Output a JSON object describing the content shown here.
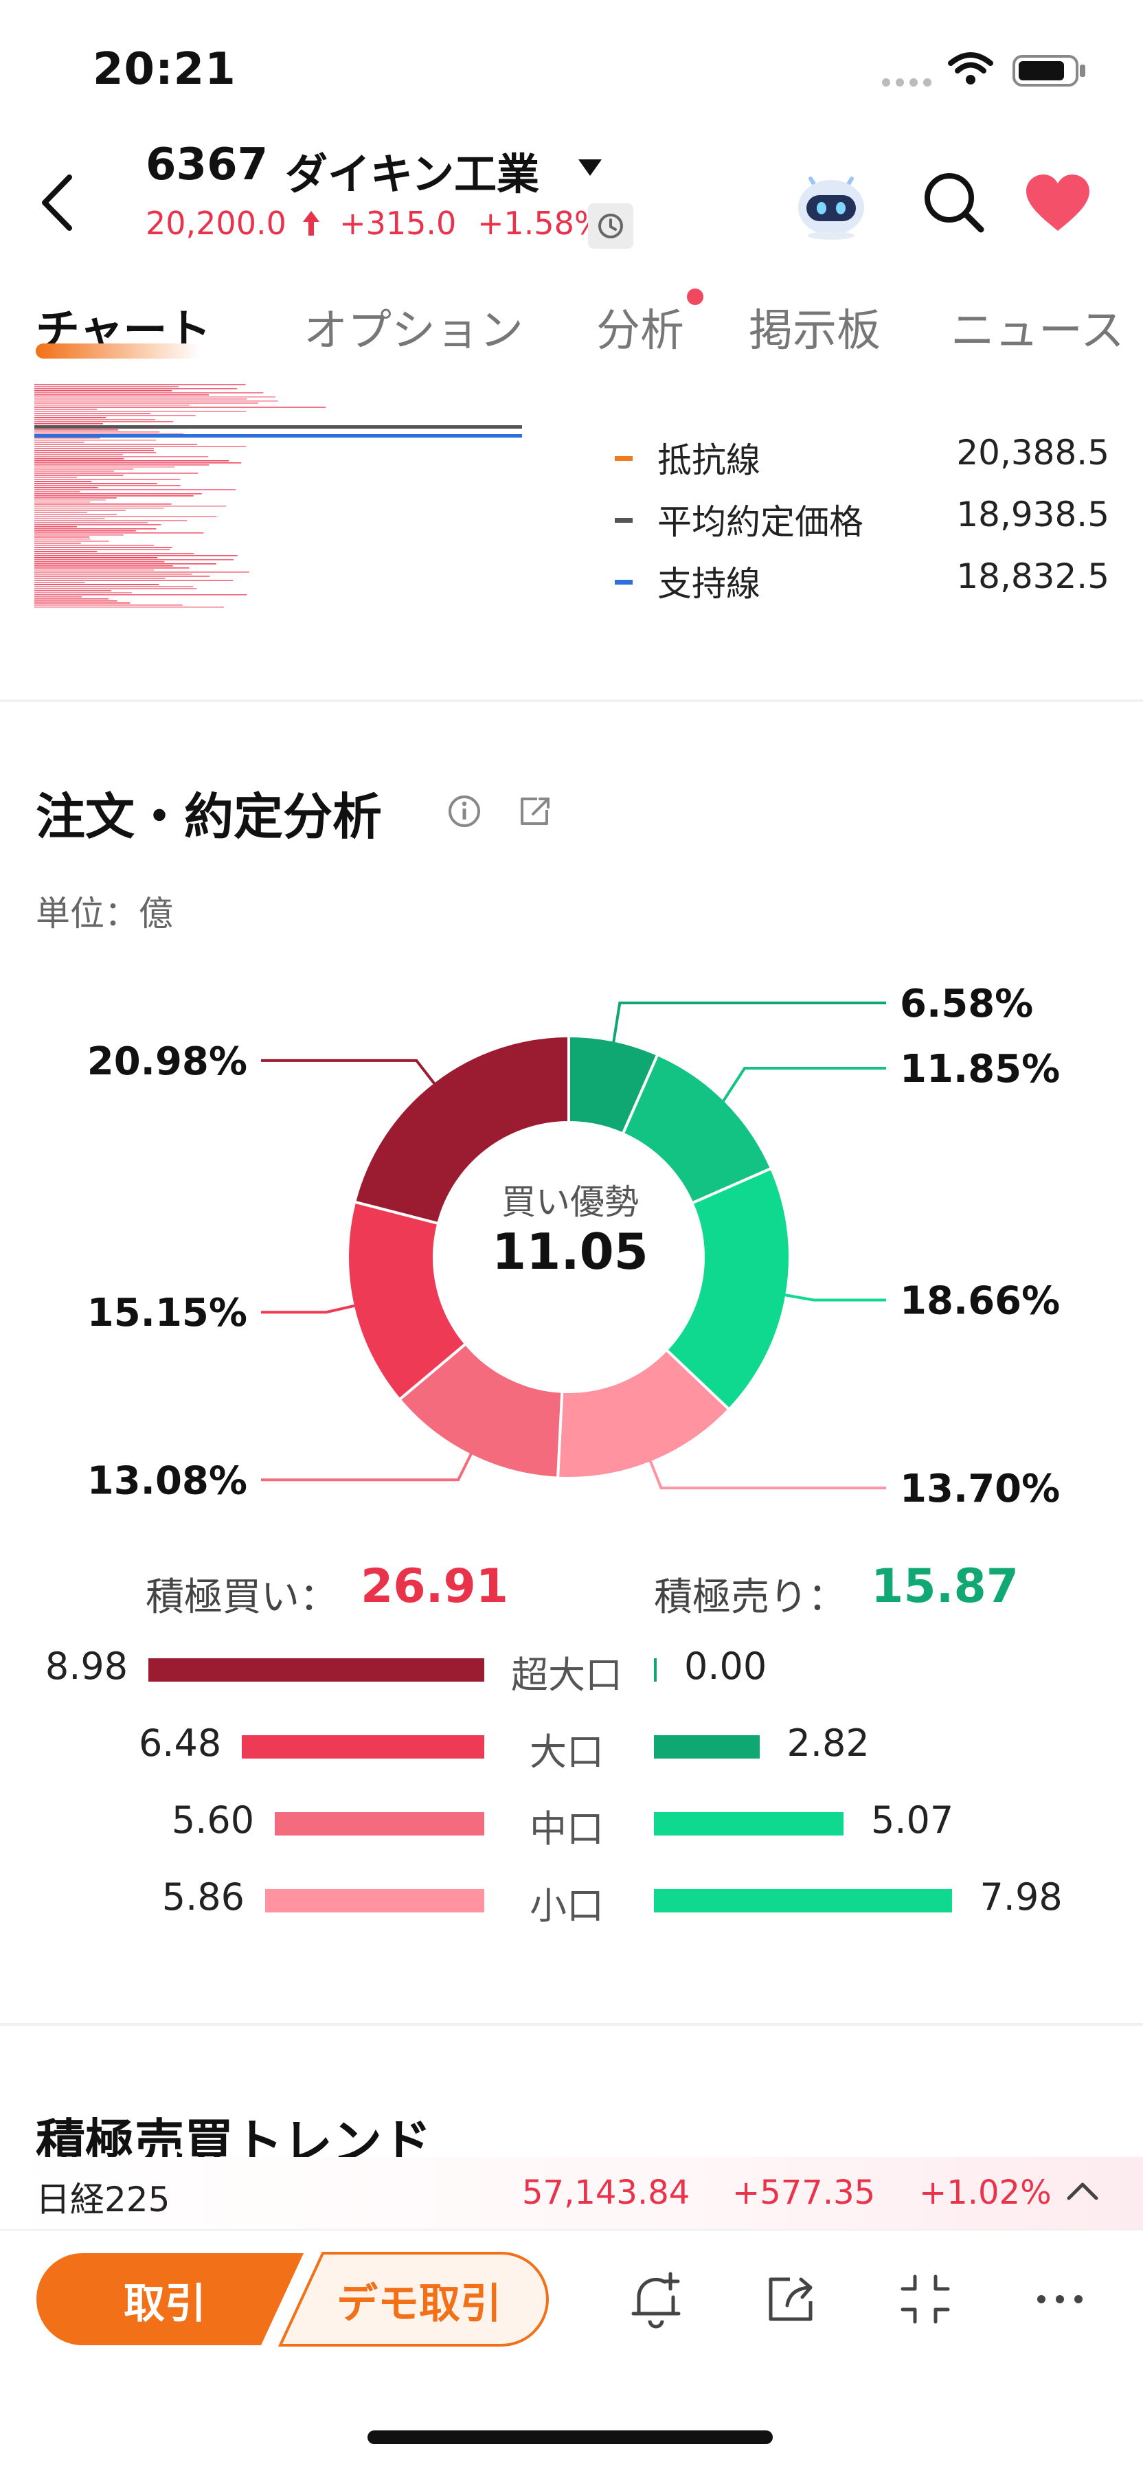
{
  "status": {
    "time": "20:21"
  },
  "header": {
    "code": "6367",
    "name": "ダイキン工業",
    "price": "20,200.0",
    "change": "+315.0",
    "change_pct": "+1.58%",
    "colors": {
      "up": "#e8334a"
    }
  },
  "tabs": [
    {
      "label": "チャート",
      "active": true
    },
    {
      "label": "オプション"
    },
    {
      "label": "分析",
      "badge": true
    },
    {
      "label": "掲示板"
    },
    {
      "label": "ニュース"
    }
  ],
  "lines_legend": [
    {
      "label": "抵抗線",
      "value": "20,388.5",
      "color": "#f07a1d"
    },
    {
      "label": "平均約定価格",
      "value": "18,938.5",
      "color": "#555555"
    },
    {
      "label": "支持線",
      "value": "18,832.5",
      "color": "#2f6fdc"
    }
  ],
  "analysis": {
    "title": "注文・約定分析",
    "unit": "単位：億",
    "center_label": "買い優勢",
    "center_value": "11.05"
  },
  "chart_data": {
    "type": "pie",
    "title": "",
    "slices": [
      {
        "label": "超大口 売り",
        "value": 6.58,
        "display": "6.58%",
        "color": "#0fa872"
      },
      {
        "label": "大口 売り",
        "value": 11.85,
        "display": "11.85%",
        "color": "#13c383"
      },
      {
        "label": "中口 売り",
        "value": 18.66,
        "display": "18.66%",
        "color": "#0fd98f"
      },
      {
        "label": "小口 売り",
        "value": 13.7,
        "display": "13.70%",
        "color": "#ff93a0"
      },
      {
        "label": "小口 買い",
        "value": 13.08,
        "display": "13.08%",
        "color": "#f46b7d"
      },
      {
        "label": "中口 買い",
        "value": 15.15,
        "display": "15.15%",
        "color": "#ef3a55"
      },
      {
        "label": "超大口 買い",
        "value": 20.98,
        "display": "20.98%",
        "color": "#9b1c30"
      }
    ]
  },
  "summary": {
    "buy_label": "積極買い：",
    "buy_value": "26.91",
    "sell_label": "積極売り：",
    "sell_value": "15.87",
    "buy_color": "#e8334a",
    "sell_color": "#11a874"
  },
  "breakdown": [
    {
      "category": "超大口",
      "buy": 8.98,
      "sell": 0.0,
      "buy_text": "8.98",
      "sell_text": "0.00",
      "buy_color": "#9b1c30",
      "sell_color": "#0fa872"
    },
    {
      "category": "大口",
      "buy": 6.48,
      "sell": 2.82,
      "buy_text": "6.48",
      "sell_text": "2.82",
      "buy_color": "#ef3a55",
      "sell_color": "#0fa872"
    },
    {
      "category": "中口",
      "buy": 5.6,
      "sell": 5.07,
      "buy_text": "5.60",
      "sell_text": "5.07",
      "buy_color": "#f46b7d",
      "sell_color": "#0fd98f"
    },
    {
      "category": "小口",
      "buy": 5.86,
      "sell": 7.98,
      "buy_text": "5.86",
      "sell_text": "7.98",
      "buy_color": "#ff93a0",
      "sell_color": "#0fd98f"
    }
  ],
  "trend": {
    "title": "積極売買トレンド"
  },
  "ticker": {
    "name": "日経225",
    "value": "57,143.84",
    "change": "+577.35",
    "pct": "+1.02%"
  },
  "bottom": {
    "trade": "取引",
    "demo": "デモ取引",
    "brand": "#f27018"
  }
}
